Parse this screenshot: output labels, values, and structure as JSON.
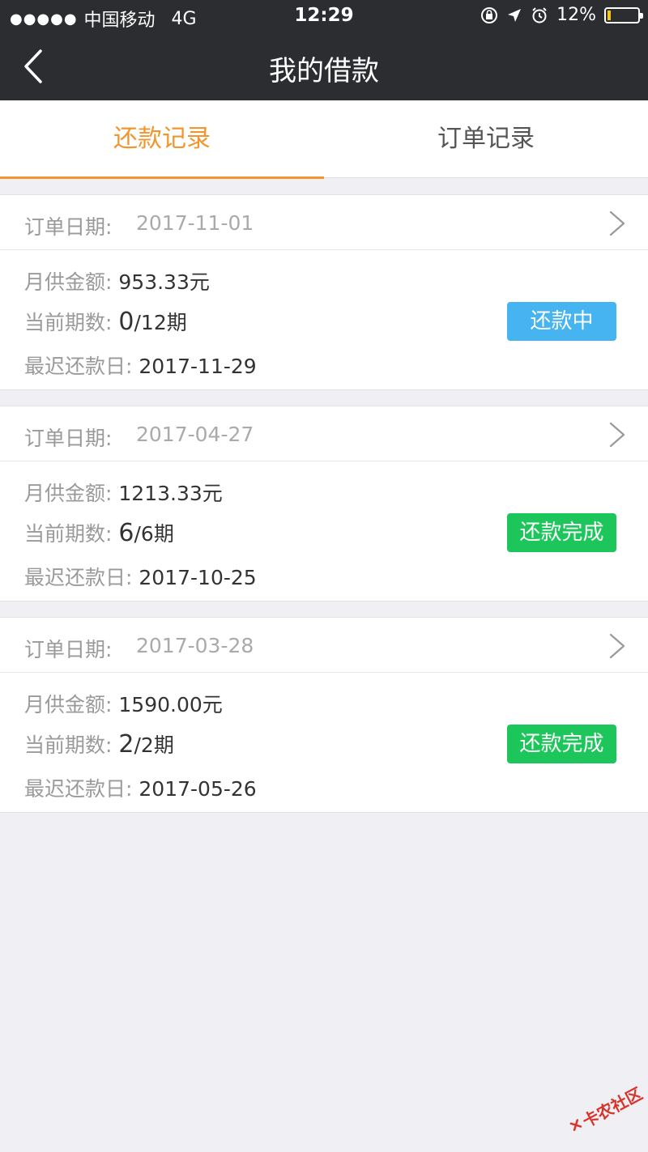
{
  "status_bar": {
    "signal": "●●●●●",
    "carrier": "中国移动",
    "network": "4G",
    "time": "12:29",
    "battery": "12%",
    "battery_level": 0.12,
    "battery_color": "#f5c518"
  },
  "nav": {
    "title": "我的借款",
    "back_icon": "chevron-left-icon"
  },
  "tabs": [
    {
      "label": "还款记录",
      "active": true
    },
    {
      "label": "订单记录",
      "active": false
    }
  ],
  "labels": {
    "order_date": "订单日期:",
    "monthly_amount": "月供金额:",
    "current_period": "当前期数:",
    "latest_due": "最迟还款日:"
  },
  "orders": [
    {
      "order_date": "2017-11-01",
      "monthly_amount": "953.33元",
      "period_current": "0",
      "period_total": "/12期",
      "due_date": "2017-11-29",
      "status": "还款中",
      "status_color": "#45b4f0"
    },
    {
      "order_date": "2017-04-27",
      "monthly_amount": "1213.33元",
      "period_current": "6",
      "period_total": "/6期",
      "due_date": "2017-10-25",
      "status": "还款完成",
      "status_color": "#1cc65a"
    },
    {
      "order_date": "2017-03-28",
      "monthly_amount": "1590.00元",
      "period_current": "2",
      "period_total": "/2期",
      "due_date": "2017-05-26",
      "status": "还款完成",
      "status_color": "#1cc65a"
    }
  ],
  "watermark": {
    "text": "卡农社区"
  },
  "colors": {
    "accent": "#f0962d",
    "navbar": "#2b2d30",
    "background": "#efeff4"
  }
}
